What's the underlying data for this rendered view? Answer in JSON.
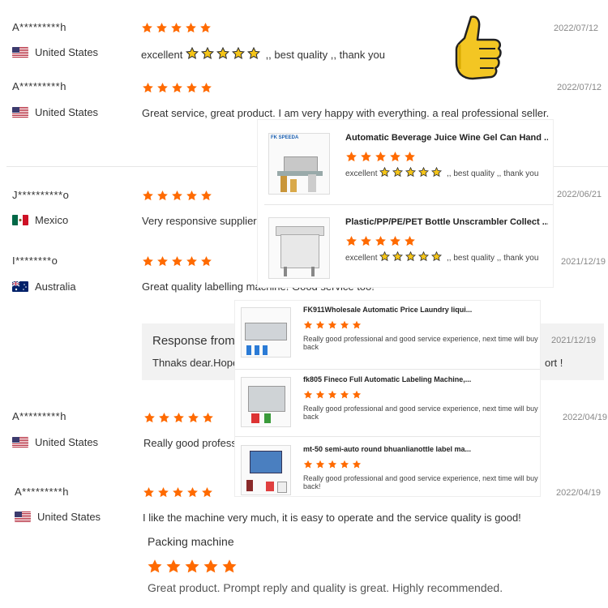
{
  "colors": {
    "star": "#ff6a00",
    "gold_star": "#f5c518",
    "thumb": "#f3c623"
  },
  "reviews": [
    {
      "name": "A*********h",
      "country": "United States",
      "date": "2022/07/12",
      "text_before": "excellent",
      "text_after": ",, best quality ,, thank you"
    },
    {
      "name": "A*********h",
      "country": "United States",
      "date": "2022/07/12",
      "text": "Great service, great product. I am very happy with everything. a real professional seller."
    },
    {
      "name": "J**********o",
      "country": "Mexico",
      "date": "2022/06/21",
      "text": "Very responsive supplier."
    },
    {
      "name": "I********o",
      "country": "Australia",
      "date": "2021/12/19",
      "text": "Great quality labelling machine! Good service too!"
    },
    {
      "name": "A*********h",
      "country": "United States",
      "date": "2022/04/19",
      "text": "Really good profess"
    },
    {
      "name": "A*********h",
      "country": "United States",
      "date": "2022/04/19",
      "text": "I like the machine very much, it is easy to operate and the service quality is good!"
    }
  ],
  "response": {
    "title": "Response from",
    "date": "2021/12/19",
    "text": "Thnaks dear.Hope",
    "text_end": "ort !"
  },
  "packing": {
    "title": "Packing machine",
    "text": "Great product. Prompt reply and quality is great. Highly recommended."
  },
  "popup1": [
    {
      "title": "Automatic Beverage Juice Wine Gel Can Hand ...",
      "review_before": "excellent",
      "review_after": ",, best quality ,, thank you",
      "logo": "FK SPEEDA"
    },
    {
      "title": "Plastic/PP/PE/PET Bottle Unscrambler Collect ...",
      "review_before": "excellent",
      "review_after": ",, best quality ,, thank you"
    }
  ],
  "popup2": [
    {
      "title": "FK911Wholesale Automatic Price Laundry liqui...",
      "review": "Really good professional and good service experience, next time will buy back"
    },
    {
      "title": "fk805 Fineco Full Automatic Labeling Machine,...",
      "review": "Really good professional and good service experience, next time will buy back"
    },
    {
      "title": "mt-50 semi-auto round bhuanlianottle label ma...",
      "review": "Really good professional and good service experience, next time will buy back!"
    }
  ]
}
